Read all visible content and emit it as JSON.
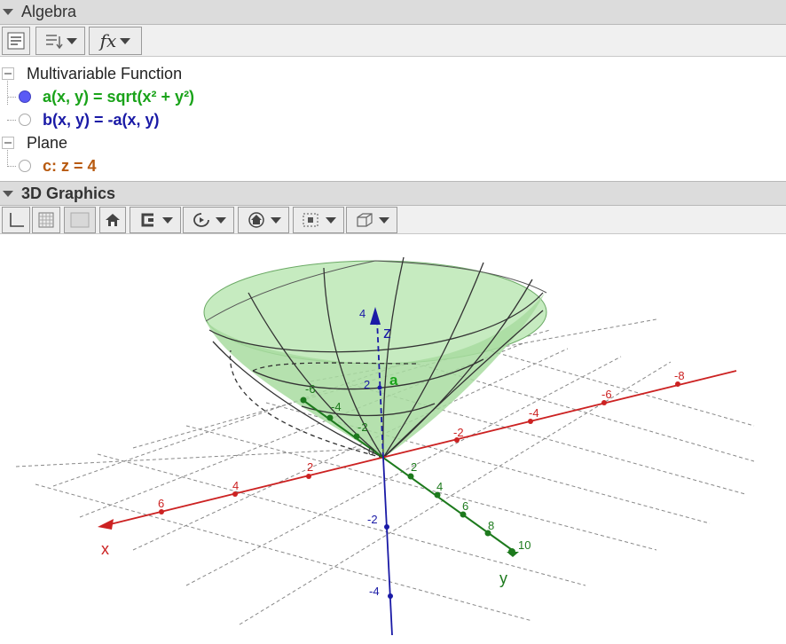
{
  "algebra": {
    "title": "Algebra",
    "groups": [
      {
        "label": "Multivariable Function",
        "items": [
          {
            "text": "a(x, y) = sqrt(x² + y²)",
            "color": "#1aa31a",
            "visible": true
          },
          {
            "text": "b(x, y) = -a(x, y)",
            "color": "#1a1aa6",
            "visible": false
          }
        ]
      },
      {
        "label": "Plane",
        "items": [
          {
            "text": "c: z = 4",
            "color": "#b85a10",
            "visible": false
          }
        ]
      }
    ],
    "toolbar": {
      "fx_label": "fx"
    }
  },
  "graphics3d": {
    "title": "3D Graphics",
    "axis_labels": {
      "x": "x",
      "y": "y",
      "z": "z"
    },
    "object_label": "a",
    "origin_label": "0",
    "x_ticks": [
      "-8",
      "-6",
      "-4",
      "-2",
      "2",
      "4",
      "6"
    ],
    "y_ticks": [
      "-6",
      "-4",
      "-2",
      "2",
      "4",
      "6",
      "8",
      "10"
    ],
    "z_ticks": [
      "4",
      "2",
      "-2",
      "-4"
    ],
    "colors": {
      "x_axis": "#cc2222",
      "y_axis": "#1d7a1d",
      "z_axis": "#1a1aa6",
      "surface": "#b8e6b0"
    }
  }
}
